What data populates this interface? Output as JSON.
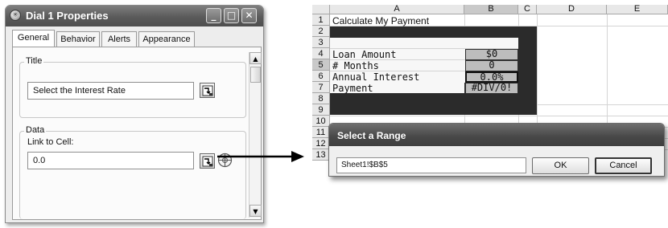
{
  "properties_dialog": {
    "title": "Dial 1 Properties",
    "window_controls": {
      "minimize": "_",
      "maximize": "□",
      "close": "✕"
    },
    "tabs": [
      "General",
      "Behavior",
      "Alerts",
      "Appearance"
    ],
    "active_tab": "General",
    "title_group": {
      "label": "Title",
      "value": "Select the Interest Rate"
    },
    "data_group": {
      "label": "Data",
      "link_label": "Link to Cell:",
      "value": "0.0"
    }
  },
  "spreadsheet": {
    "columns": [
      "A",
      "B",
      "C",
      "D",
      "E"
    ],
    "selected_column": "B",
    "rows": [
      "1",
      "2",
      "3",
      "4",
      "5",
      "6",
      "7",
      "8",
      "9",
      "10",
      "11",
      "12",
      "13"
    ],
    "selected_row": "5",
    "cells": {
      "a1": "Calculate My Payment",
      "a3": "Loan Amount",
      "a4": "# Months",
      "a5": "Annual Interest",
      "a6": "Payment",
      "b3": "$0",
      "b4": "0",
      "b5": "0.0%",
      "b6": "#DIV/0!"
    }
  },
  "range_dialog": {
    "title": "Select a Range",
    "value": "Sheet1!$B$5",
    "ok_label": "OK",
    "cancel_label": "Cancel"
  },
  "colors": {
    "title_bar": "#5a5a5a",
    "dark_block": "#2b2b2b",
    "value_cell": "#bdbdbd"
  }
}
